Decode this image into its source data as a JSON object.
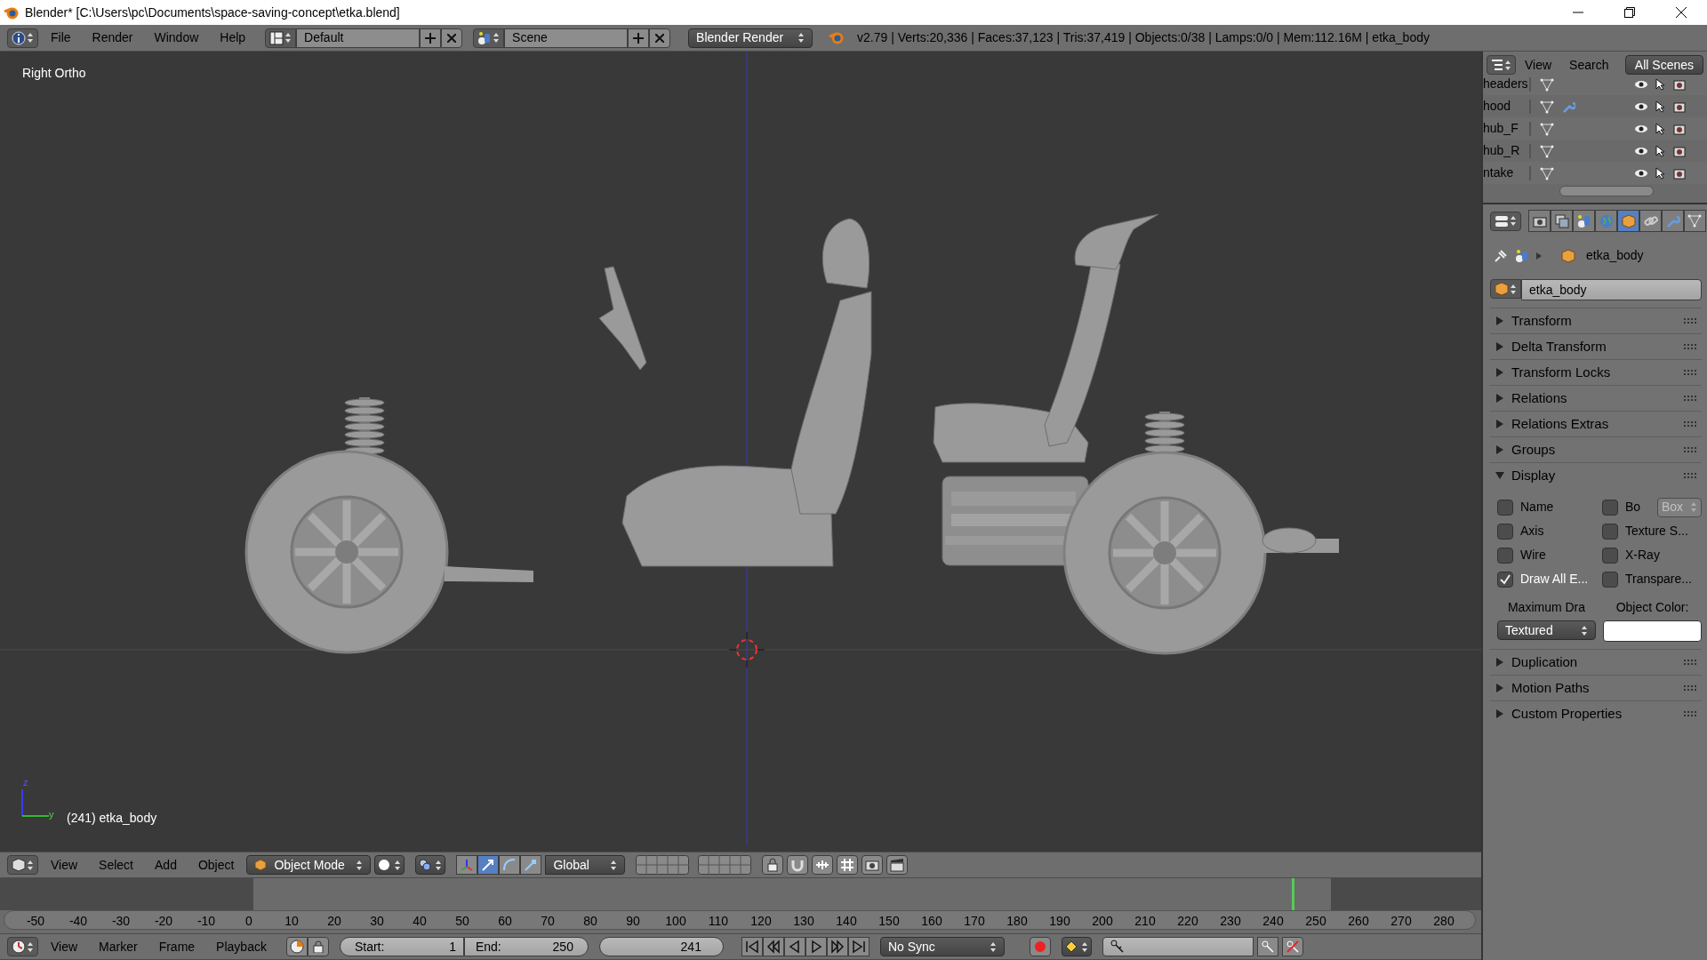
{
  "window": {
    "title": "Blender* [C:\\Users\\pc\\Documents\\space-saving-concept\\etka.blend]"
  },
  "info_header": {
    "menus": [
      "File",
      "Render",
      "Window",
      "Help"
    ],
    "screen_layout": "Default",
    "scene": "Scene",
    "render_engine": "Blender Render",
    "stats": "v2.79 | Verts:20,336 | Faces:37,123 | Tris:37,419 | Objects:0/38 | Lamps:0/0 | Mem:112.16M | etka_body"
  },
  "viewport": {
    "view_name": "Right Ortho",
    "object_info": "(241) etka_body",
    "axis_labels": [
      "z",
      "y"
    ]
  },
  "view3d_header": {
    "menus": [
      "View",
      "Select",
      "Add",
      "Object"
    ],
    "mode": "Object Mode",
    "orientation": "Global"
  },
  "timeline": {
    "ticks": [
      "-50",
      "-40",
      "-30",
      "-20",
      "-10",
      "0",
      "10",
      "20",
      "30",
      "40",
      "50",
      "60",
      "70",
      "80",
      "90",
      "100",
      "110",
      "120",
      "130",
      "140",
      "150",
      "160",
      "170",
      "180",
      "190",
      "200",
      "210",
      "220",
      "230",
      "240",
      "250",
      "260",
      "270",
      "280"
    ],
    "playhead": {
      "level": 0.882
    }
  },
  "timeline_header": {
    "menus": [
      "View",
      "Marker",
      "Frame",
      "Playback"
    ],
    "start_label": "Start:",
    "start": "1",
    "end_label": "End:",
    "end": "250",
    "current_frame": "241",
    "sync": "No Sync"
  },
  "outliner": {
    "menus": [
      "View",
      "Search"
    ],
    "filter": "All Scenes",
    "rows": [
      {
        "name": "headers",
        "has_modifier": false
      },
      {
        "name": "hood",
        "has_modifier": true
      },
      {
        "name": "hub_F",
        "has_modifier": false
      },
      {
        "name": "hub_R",
        "has_modifier": false
      },
      {
        "name": "ntake",
        "has_modifier": false
      }
    ]
  },
  "properties": {
    "tabs": [
      {
        "kind": "render",
        "selected": false
      },
      {
        "kind": "layers",
        "selected": false
      },
      {
        "kind": "scene",
        "selected": false
      },
      {
        "kind": "world",
        "selected": false
      },
      {
        "kind": "object",
        "selected": true
      },
      {
        "kind": "constraints",
        "selected": false
      },
      {
        "kind": "modifiers",
        "selected": false
      },
      {
        "kind": "data",
        "selected": false
      }
    ],
    "breadcrumb": "etka_body",
    "object_name": "etka_body",
    "panels": [
      {
        "title": "Transform",
        "expanded": false
      },
      {
        "title": "Delta Transform",
        "expanded": false
      },
      {
        "title": "Transform Locks",
        "expanded": false
      },
      {
        "title": "Relations",
        "expanded": false
      },
      {
        "title": "Relations Extras",
        "expanded": false
      },
      {
        "title": "Groups",
        "expanded": false
      },
      {
        "title": "Display",
        "expanded": true,
        "options": [
          {
            "label": "Name",
            "checked": false
          },
          {
            "label": "Bo",
            "checked": false,
            "select": "Box"
          },
          {
            "label": "Axis",
            "checked": false
          },
          {
            "label": "Texture S...",
            "checked": false
          },
          {
            "label": "Wire",
            "checked": false
          },
          {
            "label": "X-Ray",
            "checked": false
          },
          {
            "label": "Draw All E...",
            "checked": true
          },
          {
            "label": "Transpare...",
            "checked": false
          }
        ],
        "max_draw_label": "Maximum Dra",
        "max_draw": "Textured",
        "color_label": "Object Color:"
      },
      {
        "title": "Duplication",
        "expanded": false
      },
      {
        "title": "Motion Paths",
        "expanded": false
      },
      {
        "title": "Custom Properties",
        "expanded": false
      }
    ]
  }
}
